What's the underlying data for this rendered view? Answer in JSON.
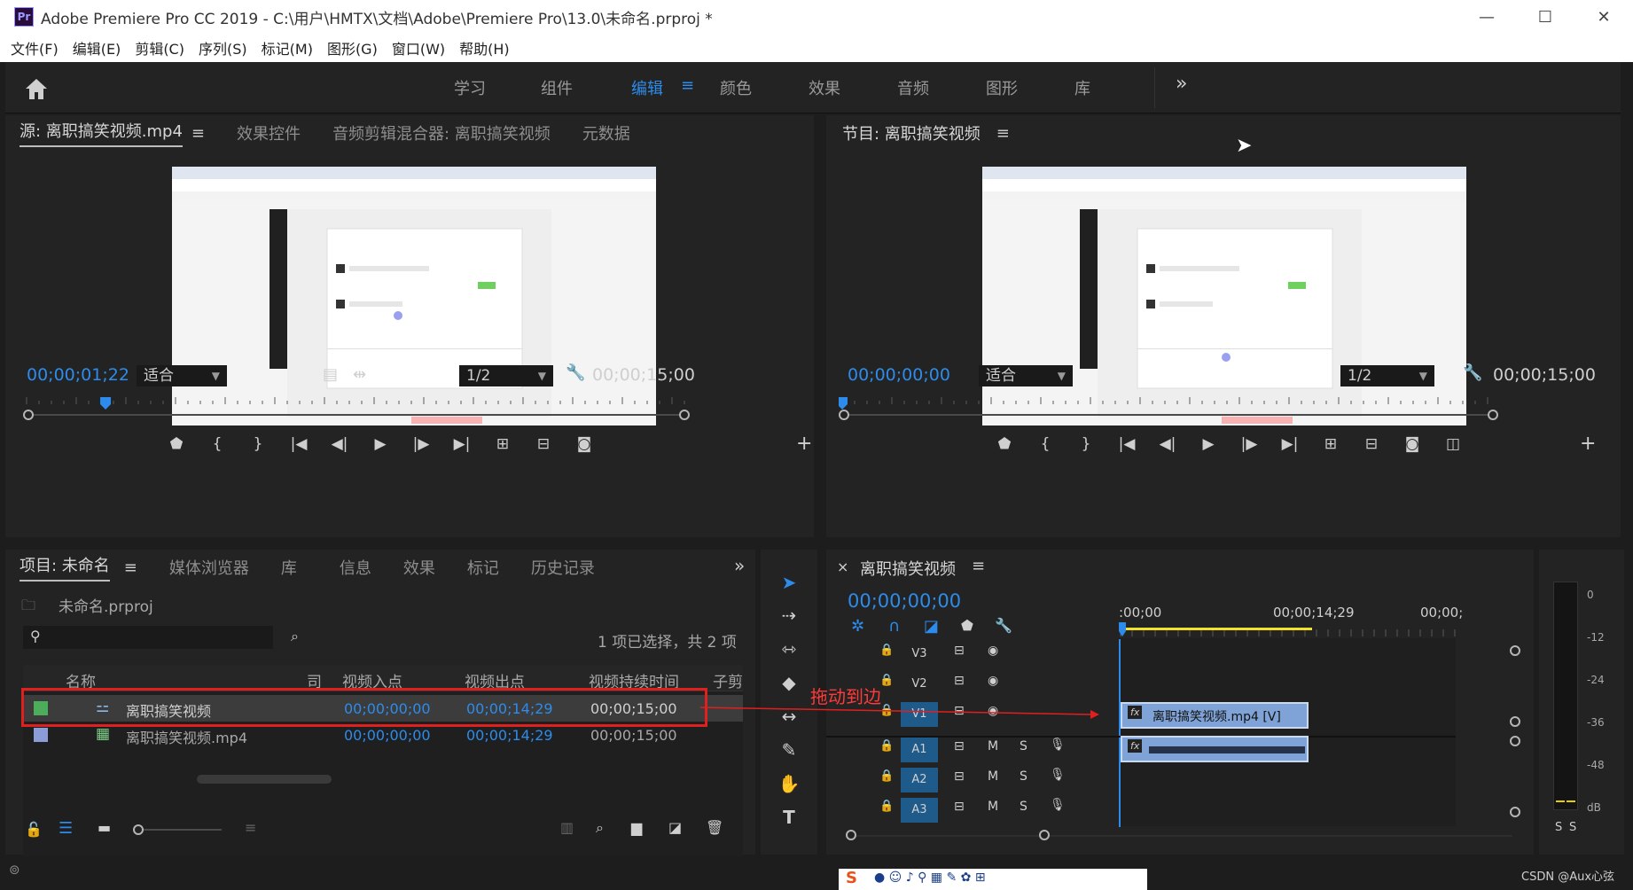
{
  "window": {
    "app_logo": "Pr",
    "title": "Adobe Premiere Pro CC 2019 - C:\\用户\\HMTX\\文档\\Adobe\\Premiere Pro\\13.0\\未命名.prproj *",
    "minimize": "—",
    "maximize": "☐",
    "close": "✕"
  },
  "menu": [
    "文件(F)",
    "编辑(E)",
    "剪辑(C)",
    "序列(S)",
    "标记(M)",
    "图形(G)",
    "窗口(W)",
    "帮助(H)"
  ],
  "workspace": {
    "tabs": [
      "学习",
      "组件",
      "编辑",
      "颜色",
      "效果",
      "音频",
      "图形",
      "库"
    ],
    "active": "编辑",
    "more": "»"
  },
  "source_panel": {
    "tabs": [
      "源: 离职搞笑视频.mp4",
      "效果控件",
      "音频剪辑混合器: 离职搞笑视频",
      "元数据"
    ],
    "timecode": "00;00;01;22",
    "fit": "适合",
    "resolution": "1/2",
    "duration": "00;00;15;00",
    "playhead_fraction": 0.12
  },
  "program_panel": {
    "tab": "节目: 离职搞笑视频",
    "timecode": "00;00;00;00",
    "fit": "适合",
    "resolution": "1/2",
    "duration": "00;00;15;00",
    "playhead_fraction": 0.0
  },
  "project_panel": {
    "tabs": [
      "项目: 未命名",
      "媒体浏览器",
      "库",
      "信息",
      "效果",
      "标记",
      "历史记录"
    ],
    "more": "»",
    "project_file": "未命名.prproj",
    "selection_info": "1 项已选择，共 2 项",
    "columns": [
      "名称",
      "司",
      "视频入点",
      "视频出点",
      "视频持续时间",
      "子剪"
    ],
    "rows": [
      {
        "name": "离职搞笑视频",
        "in": "00;00;00;00",
        "out": "00;00;14;29",
        "duration": "00;00;15;00",
        "color": "#4cae5a",
        "selected": true
      },
      {
        "name": "离职搞笑视频.mp4",
        "in": "00;00;00;00",
        "out": "00;00;14;29",
        "duration": "00;00;15;00",
        "color": "#8b9dd6",
        "selected": false
      }
    ]
  },
  "annotation": {
    "text": "拖动到边"
  },
  "timeline": {
    "tab": "离职搞笑视频",
    "close": "×",
    "timecode": "00;00;00;00",
    "ruler_labels": [
      ":00;00",
      "00;00;14;29",
      "00;00;"
    ],
    "video_tracks": [
      "V3",
      "V2",
      "V1"
    ],
    "audio_tracks": [
      "A1",
      "A2",
      "A3"
    ],
    "mute_label": "M",
    "solo_label": "S",
    "video_clip": "离职搞笑视频.mp4 [V]",
    "fx_label": "fx"
  },
  "audio_meter": {
    "labels": [
      "0",
      "-12",
      "-24",
      "-36",
      "-48",
      "dB"
    ],
    "solo": [
      "S",
      "S"
    ]
  },
  "watermark": "CSDN @Aux心弦",
  "colors": {
    "accent": "#2d8ceb",
    "highlight_box": "#e0201e",
    "work_area": "#f2e12b"
  }
}
